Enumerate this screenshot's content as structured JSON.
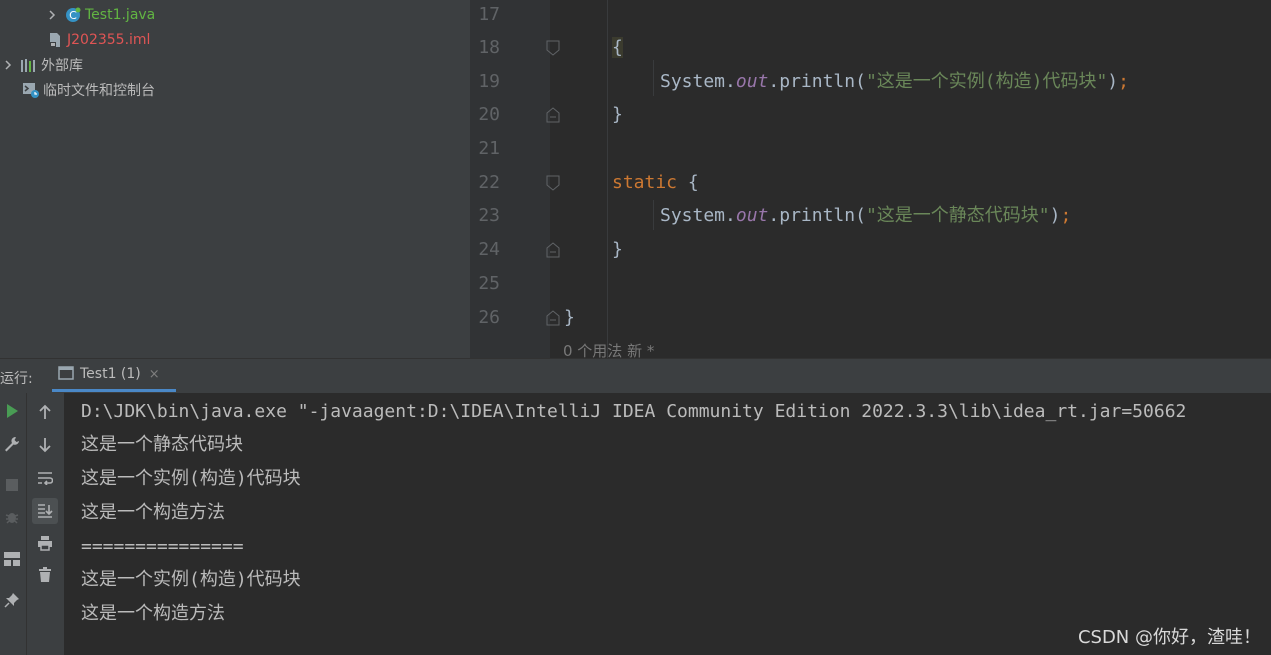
{
  "project_tree": {
    "items": [
      {
        "label": "Test1.java",
        "color": "#62b543"
      },
      {
        "label": "J202355.iml",
        "color": "#e05555"
      },
      {
        "label": "外部库",
        "color": "#bbbbbb"
      },
      {
        "label": "临时文件和控制台",
        "color": "#bbbbbb"
      }
    ]
  },
  "editor": {
    "line_numbers": [
      "17",
      "18",
      "19",
      "20",
      "21",
      "22",
      "23",
      "24",
      "25",
      "26"
    ],
    "code": {
      "l18_brace": "{",
      "l19_obj": "System",
      "l19_dot1": ".",
      "l19_field": "out",
      "l19_call": ".println(",
      "l19_string": "\"这是一个实例(构造)代码块\"",
      "l19_close": ")",
      "l19_semi": ";",
      "l20_brace": "}",
      "l22_kw": "static",
      "l22_brace": " {",
      "l23_obj": "System",
      "l23_dot1": ".",
      "l23_field": "out",
      "l23_call": ".println(",
      "l23_string": "\"这是一个静态代码块\"",
      "l23_close": ")",
      "l23_semi": ";",
      "l24_brace": "}",
      "l26_brace": "}"
    },
    "inlay_hint": "0 个用法   新 *"
  },
  "run_panel": {
    "label": "运行:",
    "tab_label": "Test1 (1)",
    "tab_close": "×",
    "console_lines": [
      "D:\\JDK\\bin\\java.exe \"-javaagent:D:\\IDEA\\IntelliJ IDEA Community Edition 2022.3.3\\lib\\idea_rt.jar=50662",
      "这是一个静态代码块",
      "这是一个实例(构造)代码块",
      "这是一个构造方法",
      "===============",
      "这是一个实例(构造)代码块",
      "这是一个构造方法"
    ]
  },
  "watermark": "CSDN @你好，渣哇！",
  "colors": {
    "run_green": "#499c54",
    "tab_underline": "#4a88c7",
    "keyword": "#cc7832",
    "string": "#6a8759",
    "field": "#9876aa"
  }
}
